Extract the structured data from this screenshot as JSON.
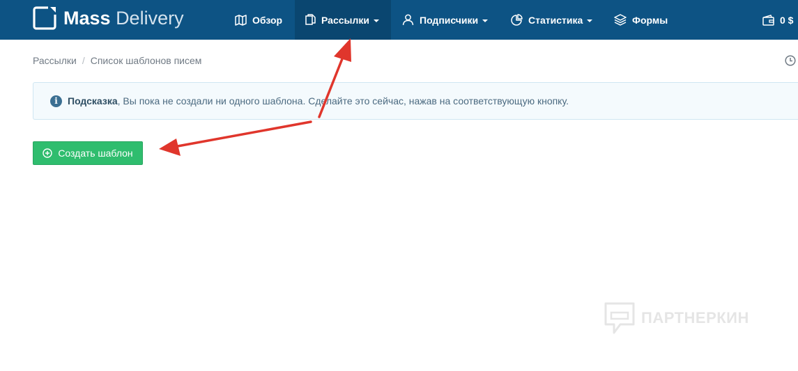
{
  "app": {
    "logo_word_1": "Mass",
    "logo_word_2": "Delivery"
  },
  "nav": {
    "overview": "Обзор",
    "campaigns": "Рассылки",
    "subscribers": "Подписчики",
    "statistics": "Статистика",
    "forms": "Формы",
    "balance": "0 $"
  },
  "icons": {
    "logo": "logo-square-icon",
    "overview": "map-icon",
    "campaigns": "documents-icon",
    "subscribers": "user-icon",
    "statistics": "pie-chart-icon",
    "forms": "layers-icon",
    "balance": "wallet-icon",
    "history": "clock-icon",
    "hint": "info-icon",
    "create": "plus-circle-icon"
  },
  "breadcrumb": {
    "parent": "Рассылки",
    "separator": "/",
    "current": "Список шаблонов писем"
  },
  "alert": {
    "title": "Подсказка",
    "message": ", Вы пока не создали ни одного шаблона. Сделайте это сейчас, нажав на соответствующую кнопку."
  },
  "actions": {
    "create_template": "Создать шаблон"
  },
  "watermark": {
    "text": "ПАРТНЕРКИН"
  },
  "colors": {
    "navbar": "#0d5384",
    "navbar_active": "#0a4670",
    "create_button": "#2fbd6e",
    "alert_background": "#f4fafd",
    "annotation_arrow": "#e0362c"
  }
}
